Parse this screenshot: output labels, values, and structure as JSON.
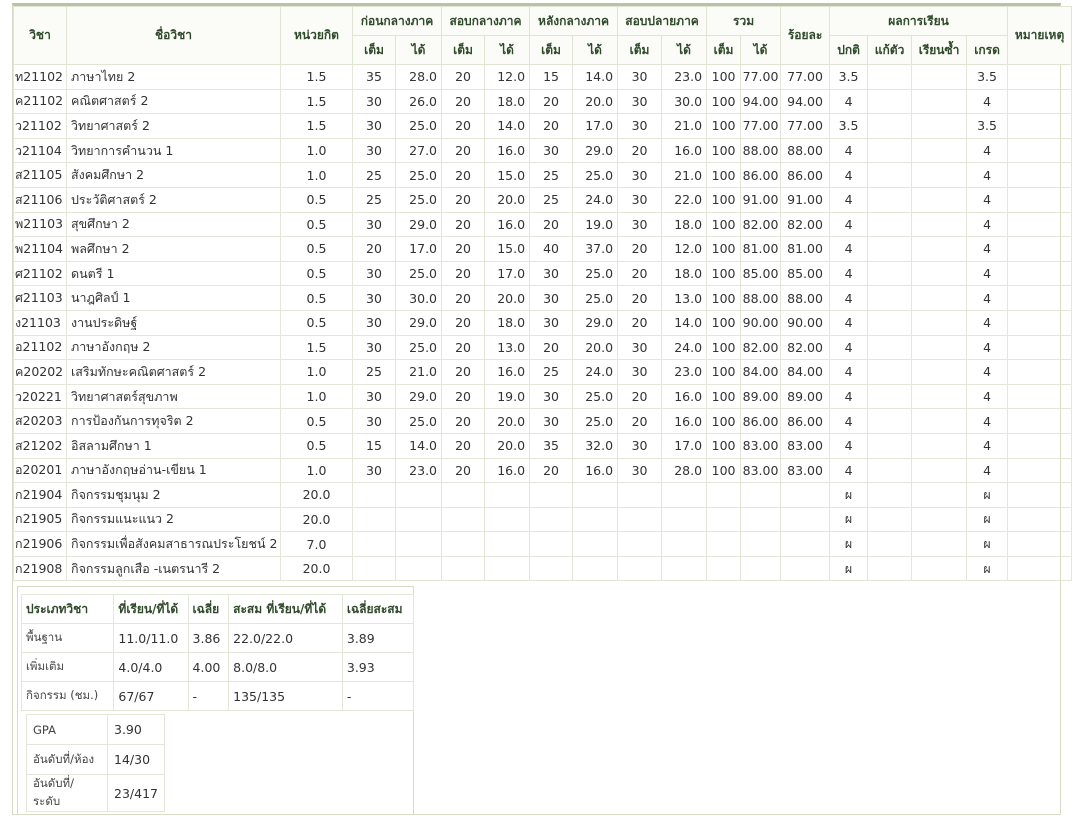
{
  "headers": {
    "code": "วิชา",
    "name": "ชื่อวิชา",
    "credit": "หน่วยกิต",
    "before_mid": "ก่อนกลางภาค",
    "mid_exam": "สอบกลางภาค",
    "after_mid": "หลังกลางภาค",
    "final_exam": "สอบปลายภาค",
    "total": "รวม",
    "percent": "ร้อยละ",
    "result": "ผลการเรียน",
    "note": "หมายเหตุ",
    "full": "เต็ม",
    "got": "ได้",
    "normal": "ปกติ",
    "fix": "แก้ตัว",
    "repeat": "เรียนซ้ำ",
    "grade": "เกรด"
  },
  "rows": [
    {
      "code": "ท21102",
      "name": "ภาษาไทย  2",
      "credit": "1.5",
      "b_full": "35",
      "b_got": "28.0",
      "m_full": "20",
      "m_got": "12.0",
      "a_full": "15",
      "a_got": "14.0",
      "f_full": "30",
      "f_got": "23.0",
      "t_full": "100",
      "t_got": "77.00",
      "pct": "77.00",
      "normal": "3.5",
      "fix": "",
      "repeat": "",
      "grade": "3.5"
    },
    {
      "code": "ค21102",
      "name": "คณิตศาสตร์  2",
      "credit": "1.5",
      "b_full": "30",
      "b_got": "26.0",
      "m_full": "20",
      "m_got": "18.0",
      "a_full": "20",
      "a_got": "20.0",
      "f_full": "30",
      "f_got": "30.0",
      "t_full": "100",
      "t_got": "94.00",
      "pct": "94.00",
      "normal": "4",
      "fix": "",
      "repeat": "",
      "grade": "4"
    },
    {
      "code": "ว21102",
      "name": "วิทยาศาสตร์  2",
      "credit": "1.5",
      "b_full": "30",
      "b_got": "25.0",
      "m_full": "20",
      "m_got": "14.0",
      "a_full": "20",
      "a_got": "17.0",
      "f_full": "30",
      "f_got": "21.0",
      "t_full": "100",
      "t_got": "77.00",
      "pct": "77.00",
      "normal": "3.5",
      "fix": "",
      "repeat": "",
      "grade": "3.5"
    },
    {
      "code": "ว21104",
      "name": "วิทยาการคำนวน  1",
      "credit": "1.0",
      "b_full": "30",
      "b_got": "27.0",
      "m_full": "20",
      "m_got": "16.0",
      "a_full": "30",
      "a_got": "29.0",
      "f_full": "20",
      "f_got": "16.0",
      "t_full": "100",
      "t_got": "88.00",
      "pct": "88.00",
      "normal": "4",
      "fix": "",
      "repeat": "",
      "grade": "4"
    },
    {
      "code": "ส21105",
      "name": "สังคมศึกษา  2",
      "credit": "1.0",
      "b_full": "25",
      "b_got": "25.0",
      "m_full": "20",
      "m_got": "15.0",
      "a_full": "25",
      "a_got": "25.0",
      "f_full": "30",
      "f_got": "21.0",
      "t_full": "100",
      "t_got": "86.00",
      "pct": "86.00",
      "normal": "4",
      "fix": "",
      "repeat": "",
      "grade": "4"
    },
    {
      "code": "ส21106",
      "name": "ประวัติศาสตร์  2",
      "credit": "0.5",
      "b_full": "25",
      "b_got": "25.0",
      "m_full": "20",
      "m_got": "20.0",
      "a_full": "25",
      "a_got": "24.0",
      "f_full": "30",
      "f_got": "22.0",
      "t_full": "100",
      "t_got": "91.00",
      "pct": "91.00",
      "normal": "4",
      "fix": "",
      "repeat": "",
      "grade": "4"
    },
    {
      "code": "พ21103",
      "name": "สุขศึกษา  2",
      "credit": "0.5",
      "b_full": "30",
      "b_got": "29.0",
      "m_full": "20",
      "m_got": "16.0",
      "a_full": "20",
      "a_got": "19.0",
      "f_full": "30",
      "f_got": "18.0",
      "t_full": "100",
      "t_got": "82.00",
      "pct": "82.00",
      "normal": "4",
      "fix": "",
      "repeat": "",
      "grade": "4"
    },
    {
      "code": "พ21104",
      "name": "พลศึกษา  2",
      "credit": "0.5",
      "b_full": "20",
      "b_got": "17.0",
      "m_full": "20",
      "m_got": "15.0",
      "a_full": "40",
      "a_got": "37.0",
      "f_full": "20",
      "f_got": "12.0",
      "t_full": "100",
      "t_got": "81.00",
      "pct": "81.00",
      "normal": "4",
      "fix": "",
      "repeat": "",
      "grade": "4"
    },
    {
      "code": "ศ21102",
      "name": "ดนตรี  1",
      "credit": "0.5",
      "b_full": "30",
      "b_got": "25.0",
      "m_full": "20",
      "m_got": "17.0",
      "a_full": "30",
      "a_got": "25.0",
      "f_full": "20",
      "f_got": "18.0",
      "t_full": "100",
      "t_got": "85.00",
      "pct": "85.00",
      "normal": "4",
      "fix": "",
      "repeat": "",
      "grade": "4"
    },
    {
      "code": "ศ21103",
      "name": "นาฎศิลป์  1",
      "credit": "0.5",
      "b_full": "30",
      "b_got": "30.0",
      "m_full": "20",
      "m_got": "20.0",
      "a_full": "30",
      "a_got": "25.0",
      "f_full": "20",
      "f_got": "13.0",
      "t_full": "100",
      "t_got": "88.00",
      "pct": "88.00",
      "normal": "4",
      "fix": "",
      "repeat": "",
      "grade": "4"
    },
    {
      "code": "ง21103",
      "name": "งานประดิษฐ์",
      "credit": "0.5",
      "b_full": "30",
      "b_got": "29.0",
      "m_full": "20",
      "m_got": "18.0",
      "a_full": "30",
      "a_got": "29.0",
      "f_full": "20",
      "f_got": "14.0",
      "t_full": "100",
      "t_got": "90.00",
      "pct": "90.00",
      "normal": "4",
      "fix": "",
      "repeat": "",
      "grade": "4"
    },
    {
      "code": "อ21102",
      "name": "ภาษาอังกฤษ  2",
      "credit": "1.5",
      "b_full": "30",
      "b_got": "25.0",
      "m_full": "20",
      "m_got": "13.0",
      "a_full": "20",
      "a_got": "20.0",
      "f_full": "30",
      "f_got": "24.0",
      "t_full": "100",
      "t_got": "82.00",
      "pct": "82.00",
      "normal": "4",
      "fix": "",
      "repeat": "",
      "grade": "4"
    },
    {
      "code": "ค20202",
      "name": "เสริมทักษะคณิตศาสตร์  2",
      "credit": "1.0",
      "b_full": "25",
      "b_got": "21.0",
      "m_full": "20",
      "m_got": "16.0",
      "a_full": "25",
      "a_got": "24.0",
      "f_full": "30",
      "f_got": "23.0",
      "t_full": "100",
      "t_got": "84.00",
      "pct": "84.00",
      "normal": "4",
      "fix": "",
      "repeat": "",
      "grade": "4"
    },
    {
      "code": "ว20221",
      "name": "วิทยาศาสตร์สุขภาพ",
      "credit": "1.0",
      "b_full": "30",
      "b_got": "29.0",
      "m_full": "20",
      "m_got": "19.0",
      "a_full": "30",
      "a_got": "25.0",
      "f_full": "20",
      "f_got": "16.0",
      "t_full": "100",
      "t_got": "89.00",
      "pct": "89.00",
      "normal": "4",
      "fix": "",
      "repeat": "",
      "grade": "4"
    },
    {
      "code": "ส20203",
      "name": "การป้องกันการทุจริต  2",
      "credit": "0.5",
      "b_full": "30",
      "b_got": "25.0",
      "m_full": "20",
      "m_got": "20.0",
      "a_full": "30",
      "a_got": "25.0",
      "f_full": "20",
      "f_got": "16.0",
      "t_full": "100",
      "t_got": "86.00",
      "pct": "86.00",
      "normal": "4",
      "fix": "",
      "repeat": "",
      "grade": "4"
    },
    {
      "code": "ส21202",
      "name": "อิสลามศึกษา  1",
      "credit": "0.5",
      "b_full": "15",
      "b_got": "14.0",
      "m_full": "20",
      "m_got": "20.0",
      "a_full": "35",
      "a_got": "32.0",
      "f_full": "30",
      "f_got": "17.0",
      "t_full": "100",
      "t_got": "83.00",
      "pct": "83.00",
      "normal": "4",
      "fix": "",
      "repeat": "",
      "grade": "4"
    },
    {
      "code": "อ20201",
      "name": "ภาษาอังกฤษอ่าน-เขียน  1",
      "credit": "1.0",
      "b_full": "30",
      "b_got": "23.0",
      "m_full": "20",
      "m_got": "16.0",
      "a_full": "20",
      "a_got": "16.0",
      "f_full": "30",
      "f_got": "28.0",
      "t_full": "100",
      "t_got": "83.00",
      "pct": "83.00",
      "normal": "4",
      "fix": "",
      "repeat": "",
      "grade": "4"
    },
    {
      "code": "ก21904",
      "name": "กิจกรรมชุมนุม  2",
      "credit": "20.0",
      "b_full": "",
      "b_got": "",
      "m_full": "",
      "m_got": "",
      "a_full": "",
      "a_got": "",
      "f_full": "",
      "f_got": "",
      "t_full": "",
      "t_got": "",
      "pct": "",
      "normal": "ผ",
      "fix": "",
      "repeat": "",
      "grade": "ผ"
    },
    {
      "code": "ก21905",
      "name": "กิจกรรมแนะแนว  2",
      "credit": "20.0",
      "b_full": "",
      "b_got": "",
      "m_full": "",
      "m_got": "",
      "a_full": "",
      "a_got": "",
      "f_full": "",
      "f_got": "",
      "t_full": "",
      "t_got": "",
      "pct": "",
      "normal": "ผ",
      "fix": "",
      "repeat": "",
      "grade": "ผ"
    },
    {
      "code": "ก21906",
      "name": "กิจกรรมเพื่อสังคมสาธารณประโยชน์  2",
      "credit": "7.0",
      "b_full": "",
      "b_got": "",
      "m_full": "",
      "m_got": "",
      "a_full": "",
      "a_got": "",
      "f_full": "",
      "f_got": "",
      "t_full": "",
      "t_got": "",
      "pct": "",
      "normal": "ผ",
      "fix": "",
      "repeat": "",
      "grade": "ผ"
    },
    {
      "code": "ก21908",
      "name": "กิจกรรมลูกเสือ  -เนตรนารี  2",
      "credit": "20.0",
      "b_full": "",
      "b_got": "",
      "m_full": "",
      "m_got": "",
      "a_full": "",
      "a_got": "",
      "f_full": "",
      "f_got": "",
      "t_full": "",
      "t_got": "",
      "pct": "",
      "normal": "ผ",
      "fix": "",
      "repeat": "",
      "grade": "ผ"
    }
  ],
  "summary": {
    "headers": {
      "type": "ประเภทวิชา",
      "studied": "ที่เรียน/ที่ได้",
      "avg": "เฉลี่ย",
      "cum_studied": "สะสม  ที่เรียน/ที่ได้",
      "cum_avg": "เฉลี่ยสะสม"
    },
    "rows": [
      {
        "type": "พื้นฐาน",
        "studied": "11.0/11.0",
        "avg": "3.86",
        "cum_studied": "22.0/22.0",
        "cum_avg": "3.89"
      },
      {
        "type": "เพิ่มเติม",
        "studied": "4.0/4.0",
        "avg": "4.00",
        "cum_studied": "8.0/8.0",
        "cum_avg": "3.93"
      },
      {
        "type": "กิจกรรม  (ชม.)",
        "studied": "67/67",
        "avg": "-",
        "cum_studied": "135/135",
        "cum_avg": "-"
      }
    ],
    "gpa_label": "GPA",
    "gpa": "3.90",
    "rank_room_label": "อันดับที่/ห้อง",
    "rank_room": "14/30",
    "rank_level_label": "อันดับที่/ระดับ",
    "rank_level": "23/417"
  }
}
